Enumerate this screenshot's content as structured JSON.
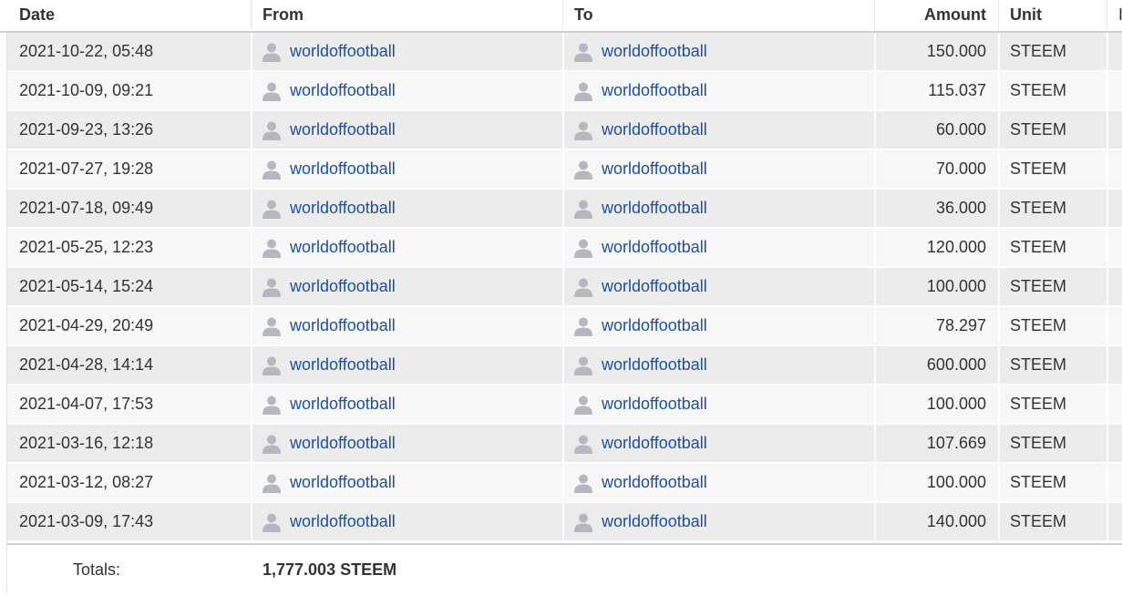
{
  "table": {
    "headers": {
      "date": "Date",
      "from": "From",
      "to": "To",
      "amount": "Amount",
      "unit": "Unit",
      "extra": "I"
    },
    "rows": [
      {
        "date": "2021-10-22, 05:48",
        "from": "worldoffootball",
        "to": "worldoffootball",
        "amount": "150.000",
        "unit": "STEEM"
      },
      {
        "date": "2021-10-09, 09:21",
        "from": "worldoffootball",
        "to": "worldoffootball",
        "amount": "115.037",
        "unit": "STEEM"
      },
      {
        "date": "2021-09-23, 13:26",
        "from": "worldoffootball",
        "to": "worldoffootball",
        "amount": "60.000",
        "unit": "STEEM"
      },
      {
        "date": "2021-07-27, 19:28",
        "from": "worldoffootball",
        "to": "worldoffootball",
        "amount": "70.000",
        "unit": "STEEM"
      },
      {
        "date": "2021-07-18, 09:49",
        "from": "worldoffootball",
        "to": "worldoffootball",
        "amount": "36.000",
        "unit": "STEEM"
      },
      {
        "date": "2021-05-25, 12:23",
        "from": "worldoffootball",
        "to": "worldoffootball",
        "amount": "120.000",
        "unit": "STEEM"
      },
      {
        "date": "2021-05-14, 15:24",
        "from": "worldoffootball",
        "to": "worldoffootball",
        "amount": "100.000",
        "unit": "STEEM"
      },
      {
        "date": "2021-04-29, 20:49",
        "from": "worldoffootball",
        "to": "worldoffootball",
        "amount": "78.297",
        "unit": "STEEM"
      },
      {
        "date": "2021-04-28, 14:14",
        "from": "worldoffootball",
        "to": "worldoffootball",
        "amount": "600.000",
        "unit": "STEEM"
      },
      {
        "date": "2021-04-07, 17:53",
        "from": "worldoffootball",
        "to": "worldoffootball",
        "amount": "100.000",
        "unit": "STEEM"
      },
      {
        "date": "2021-03-16, 12:18",
        "from": "worldoffootball",
        "to": "worldoffootball",
        "amount": "107.669",
        "unit": "STEEM"
      },
      {
        "date": "2021-03-12, 08:27",
        "from": "worldoffootball",
        "to": "worldoffootball",
        "amount": "100.000",
        "unit": "STEEM"
      },
      {
        "date": "2021-03-09, 17:43",
        "from": "worldoffootball",
        "to": "worldoffootball",
        "amount": "140.000",
        "unit": "STEEM"
      }
    ],
    "totals": {
      "label": "Totals:",
      "value": "1,777.003 STEEM"
    }
  },
  "icons": {
    "user": "user-avatar-icon"
  },
  "colors": {
    "link": "#1f4e9c",
    "row_odd": "#ececec",
    "row_even": "#f7f7f7",
    "icon": "#b5b9bf"
  }
}
